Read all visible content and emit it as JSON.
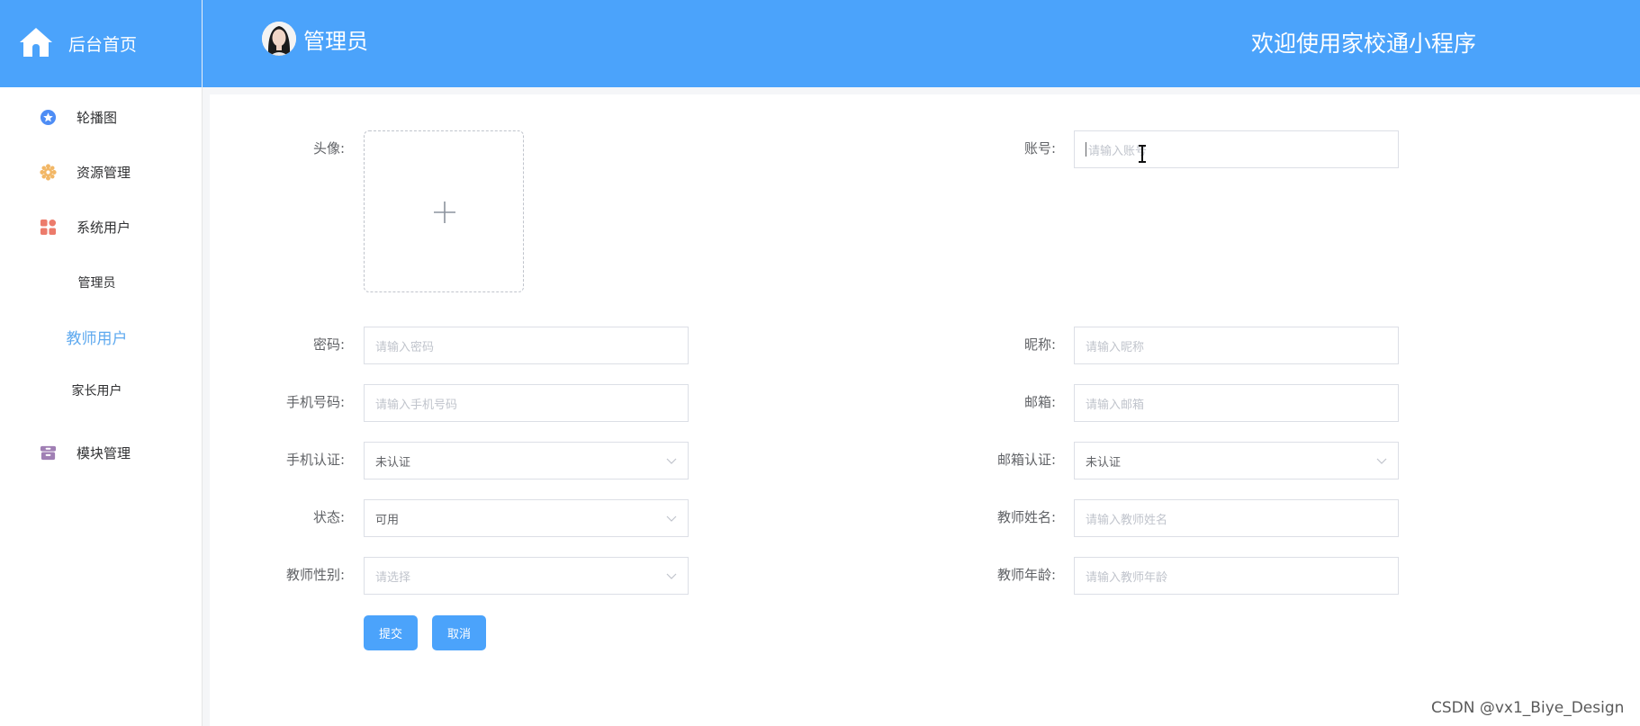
{
  "header": {
    "brand_title": "后台首页",
    "user_name": "管理员",
    "welcome": "欢迎使用家校通小程序",
    "background": "#4ba3fb"
  },
  "sidebar": {
    "items": [
      {
        "label": "轮播图",
        "icon": "star-badge-icon",
        "color": "#4e8df5"
      },
      {
        "label": "资源管理",
        "icon": "gear-flower-icon",
        "color": "#f2b766"
      },
      {
        "label": "系统用户",
        "icon": "grid-apps-icon",
        "color": "#ec7b6b"
      },
      {
        "label": "模块管理",
        "icon": "archive-box-icon",
        "color": "#a07fb4"
      }
    ],
    "sub_items": [
      {
        "label": "管理员"
      },
      {
        "label": "教师用户",
        "active": true
      },
      {
        "label": "家长用户"
      }
    ],
    "active_color": "#5ea9ef"
  },
  "form": {
    "avatar_label": "头像:",
    "account": {
      "label": "账号:",
      "placeholder": "请输入账号"
    },
    "password": {
      "label": "密码:",
      "placeholder": "请输入密码"
    },
    "nickname": {
      "label": "昵称:",
      "placeholder": "请输入昵称"
    },
    "phone": {
      "label": "手机号码:",
      "placeholder": "请输入手机号码"
    },
    "email": {
      "label": "邮箱:",
      "placeholder": "请输入邮箱"
    },
    "phone_verify": {
      "label": "手机认证:",
      "value": "未认证"
    },
    "email_verify": {
      "label": "邮箱认证:",
      "value": "未认证"
    },
    "status": {
      "label": "状态:",
      "value": "可用"
    },
    "teacher_name": {
      "label": "教师姓名:",
      "placeholder": "请输入教师姓名"
    },
    "teacher_gender": {
      "label": "教师性别:",
      "placeholder": "请选择"
    },
    "teacher_age": {
      "label": "教师年龄:",
      "placeholder": "请输入教师年龄"
    },
    "submit_label": "提交",
    "cancel_label": "取消"
  },
  "watermark": "CSDN @vx1_Biye_Design"
}
